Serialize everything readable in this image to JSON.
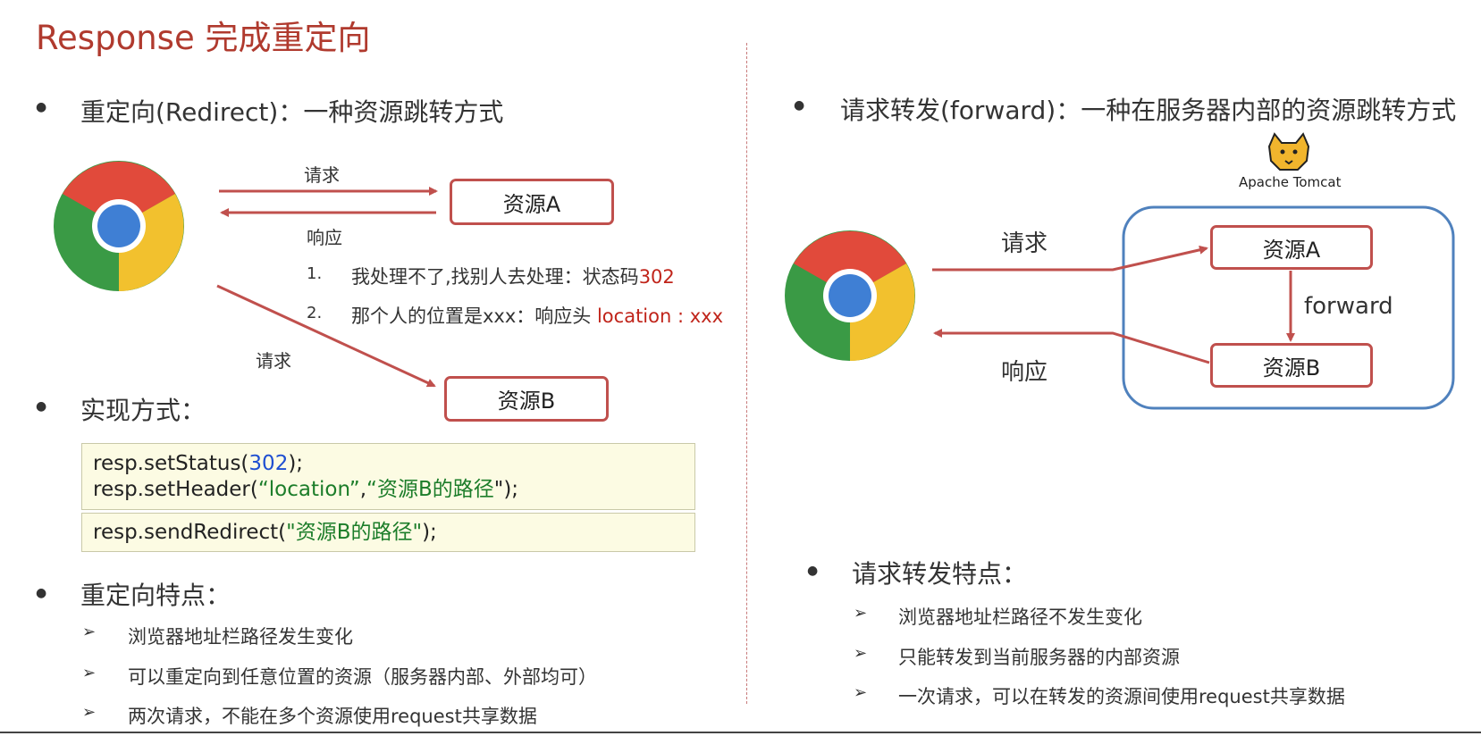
{
  "title": "Response 完成重定向",
  "left": {
    "redirect_heading": "重定向(Redirect)：一种资源跳转方式",
    "request_label_top": "请求",
    "response_label": "响应",
    "resource_a": "资源A",
    "resource_b": "资源B",
    "request_label_bottom": "请求",
    "steps": [
      {
        "num": "1.",
        "text": "我处理不了,找别人去处理：状态码",
        "highlight": "302"
      },
      {
        "num": "2.",
        "text": "那个人的位置是xxx：响应头 ",
        "highlight": "location : xxx"
      }
    ],
    "impl_heading": "实现方式：",
    "code1": {
      "l1a": "resp.setStatus(",
      "l1num": "302",
      "l1b": ");",
      "l2a": "resp.setHeader(",
      "l2s1": "“location”",
      "l2c": ",",
      "l2s2": "“资源B的路径",
      "l2b": "\");"
    },
    "code2": {
      "a": "resp.sendRedirect(",
      "s": "\"资源B的路径\"",
      "b": ");"
    },
    "features_heading": "重定向特点：",
    "features": [
      "浏览器地址栏路径发生变化",
      "可以重定向到任意位置的资源（服务器内部、外部均可）",
      "两次请求，不能在多个资源使用request共享数据"
    ]
  },
  "right": {
    "forward_heading": "请求转发(forward)：一种在服务器内部的资源跳转方式",
    "tomcat_caption": "Apache Tomcat",
    "request_label": "请求",
    "response_label": "响应",
    "resource_a": "资源A",
    "resource_b": "资源B",
    "forward_label": "forward",
    "features_heading": "请求转发特点：",
    "features": [
      "浏览器地址栏路径不发生变化",
      "只能转发到当前服务器的内部资源",
      "一次请求，可以在转发的资源间使用request共享数据"
    ]
  },
  "colors": {
    "title": "#b03a2e",
    "arrow": "#c0504d",
    "server_box": "#4f81bd",
    "code_bg": "#fcfbe3"
  }
}
